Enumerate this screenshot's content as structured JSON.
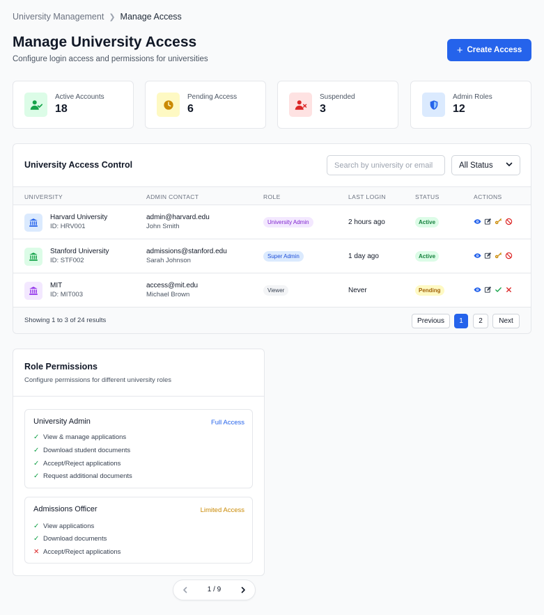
{
  "breadcrumb": {
    "parent": "University Management",
    "current": "Manage Access"
  },
  "header": {
    "title": "Manage University Access",
    "subtitle": "Configure login access and permissions for universities",
    "create_button": "Create Access"
  },
  "stats": [
    {
      "label": "Active Accounts",
      "value": "18",
      "icon": "user-check-icon",
      "color": "#16a34a",
      "bg": "#dcfce7"
    },
    {
      "label": "Pending Access",
      "value": "6",
      "icon": "clock-icon",
      "color": "#ca8a04",
      "bg": "#fef9c3"
    },
    {
      "label": "Suspended",
      "value": "3",
      "icon": "user-x-icon",
      "color": "#dc2626",
      "bg": "#fee2e2"
    },
    {
      "label": "Admin Roles",
      "value": "12",
      "icon": "shield-icon",
      "color": "#2563eb",
      "bg": "#dbeafe"
    }
  ],
  "access_control": {
    "title": "University Access Control",
    "search_placeholder": "Search by university or email",
    "status_filter": "All Status",
    "columns": [
      "UNIVERSITY",
      "ADMIN CONTACT",
      "ROLE",
      "LAST LOGIN",
      "STATUS",
      "ACTIONS"
    ],
    "rows": [
      {
        "name": "Harvard University",
        "id": "ID: HRV001",
        "email": "admin@harvard.edu",
        "contact": "John Smith",
        "role": "University Admin",
        "last_login": "2 hours ago",
        "status": "Active",
        "icon_color": "#2563eb",
        "icon_bg": "#dbeafe"
      },
      {
        "name": "Stanford University",
        "id": "ID: STF002",
        "email": "admissions@stanford.edu",
        "contact": "Sarah Johnson",
        "role": "Super Admin",
        "last_login": "1 day ago",
        "status": "Active",
        "icon_color": "#16a34a",
        "icon_bg": "#dcfce7"
      },
      {
        "name": "MIT",
        "id": "ID: MIT003",
        "email": "access@mit.edu",
        "contact": "Michael Brown",
        "role": "Viewer",
        "last_login": "Never",
        "status": "Pending",
        "icon_color": "#9333ea",
        "icon_bg": "#f3e8ff"
      }
    ],
    "footer_text": "Showing 1 to 3 of 24 results",
    "pagination": {
      "previous": "Previous",
      "page1": "1",
      "page2": "2",
      "next": "Next"
    }
  },
  "role_permissions": {
    "title": "Role Permissions",
    "subtitle": "Configure permissions for different university roles",
    "roles": [
      {
        "name": "University Admin",
        "level": "Full Access",
        "level_color": "#2563eb",
        "permissions": [
          {
            "text": "View & manage applications",
            "allowed": true
          },
          {
            "text": "Download student documents",
            "allowed": true
          },
          {
            "text": "Accept/Reject applications",
            "allowed": true
          },
          {
            "text": "Request additional documents",
            "allowed": true
          }
        ]
      },
      {
        "name": "Admissions Officer",
        "level": "Limited Access",
        "level_color": "#ca8a04",
        "permissions": [
          {
            "text": "View applications",
            "allowed": true
          },
          {
            "text": "Download documents",
            "allowed": true
          },
          {
            "text": "Accept/Reject applications",
            "allowed": false
          }
        ]
      }
    ]
  },
  "pager": {
    "text": "1 / 9"
  }
}
